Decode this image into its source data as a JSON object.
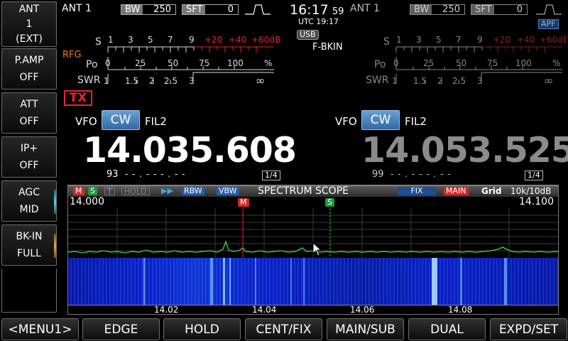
{
  "left_keys": [
    {
      "lines": [
        "ANT",
        "1",
        "(EXT)"
      ]
    },
    {
      "lines": [
        "P.AMP",
        "OFF"
      ]
    },
    {
      "lines": [
        "ATT",
        "OFF"
      ]
    },
    {
      "lines": [
        "IP+",
        "OFF"
      ]
    },
    {
      "lines": [
        "AGC",
        "MID"
      ]
    },
    {
      "lines": [
        "BK-IN",
        "FULL"
      ]
    }
  ],
  "main": {
    "ant": "ANT 1",
    "bw_label": "BW",
    "bw_value": "250",
    "sft_label": "SFT",
    "sft_value": "0",
    "rfg": "RFG",
    "tx": "TX",
    "vfo": "VFO",
    "mode": "CW",
    "filter": "FIL2",
    "frequency": "14.035.608",
    "sub_num": "93",
    "sub_dashes": "- - . - - - . - -",
    "fraction": "1/4"
  },
  "center": {
    "time": "16:17",
    "seconds": "59",
    "utc": "UTC 19:17",
    "usb": "USB",
    "mode_status": "F-BKIN"
  },
  "sub": {
    "ant": "ANT 1",
    "bw_label": "BW",
    "bw_value": "250",
    "sft_label": "SFT",
    "sft_value": "0",
    "apf": "APF",
    "vfo": "VFO",
    "mode": "CW",
    "filter": "FIL2",
    "frequency": "14.053.525",
    "sub_num": "99",
    "sub_dashes": "- - . - - - . - -",
    "fraction": "1/4"
  },
  "meter": {
    "s_label": "S",
    "po_label": "Po",
    "swr_label": "SWR",
    "s_ticks": [
      "1",
      "3",
      "5",
      "7",
      "9"
    ],
    "s_over": [
      "+20",
      "+40",
      "+60dB"
    ],
    "po_ticks": [
      "0",
      "25",
      "50",
      "75",
      "100",
      "%"
    ],
    "swr_ticks": [
      "1",
      "1.5",
      "2",
      "2.5",
      "3",
      "∞"
    ]
  },
  "scope": {
    "tag_m": "M",
    "tag_s": "S",
    "tag_t": "T",
    "hold": "HOLD",
    "arrows": "▶▶",
    "rbw": "RBW",
    "vbw": "VBW",
    "title": "SPECTRUM SCOPE",
    "fix": "FIX",
    "main": "MAIN",
    "grid": "Grid",
    "span": "10k/10dB",
    "freq_left": "14.000",
    "freq_right": "14.100",
    "marker_m": "M",
    "marker_s": "S",
    "axis": [
      "14.02",
      "14.04",
      "14.06",
      "14.08"
    ]
  },
  "menu": [
    "<MENU1>",
    "EDGE",
    "HOLD",
    "CENT/FIX",
    "MAIN/SUB",
    "DUAL",
    "EXPD/SET"
  ],
  "colors": {
    "accent_blue": "#2f69a7",
    "tx_red": "#e8242b",
    "scope_green": "#2ecc40"
  }
}
